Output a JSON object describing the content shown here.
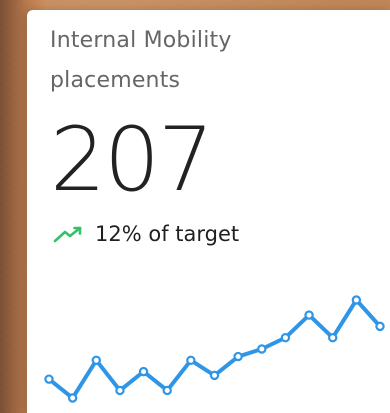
{
  "card": {
    "title_line1": "Internal Mobility",
    "title_line2": "placements",
    "metric_value": "207",
    "trend_text": "12% of target",
    "trend_icon": "trending-up-icon",
    "colors": {
      "trend_icon": "#35c06a",
      "sparkline": "#2f95e6",
      "text_muted": "#666666",
      "text_main": "#222222"
    }
  },
  "chart_data": {
    "type": "line",
    "values": [
      8,
      3,
      13,
      5,
      10,
      5,
      13,
      9,
      14,
      16,
      19,
      25,
      19,
      29,
      22
    ]
  }
}
